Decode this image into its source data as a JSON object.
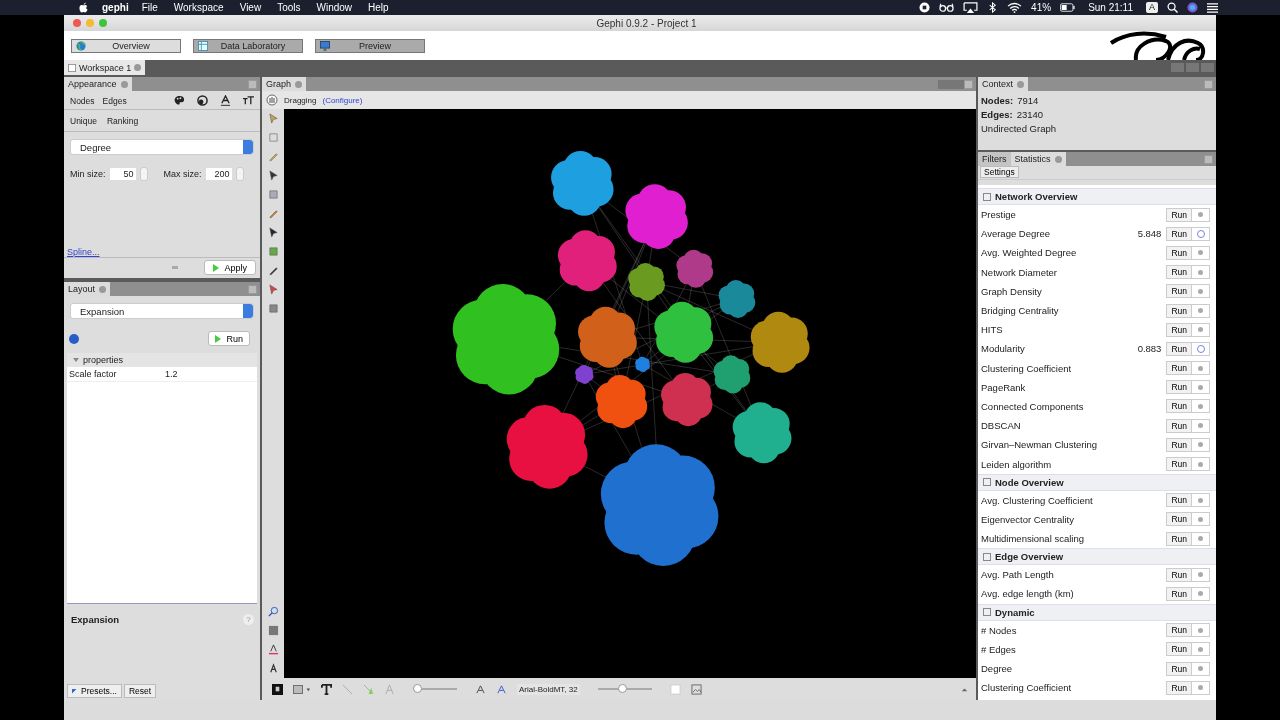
{
  "menubar": {
    "app_name": "gephi",
    "menus": [
      "File",
      "Workspace",
      "View",
      "Tools",
      "Window",
      "Help"
    ],
    "battery": "41%",
    "clock": "Sun 21:11",
    "input_source": "A"
  },
  "window": {
    "title": "Gephi 0.9.2 - Project 1"
  },
  "modes": [
    {
      "label": "Overview",
      "selected": true
    },
    {
      "label": "Data Laboratory",
      "selected": false
    },
    {
      "label": "Preview",
      "selected": false
    }
  ],
  "workspace_tabs": [
    {
      "label": "Workspace 1"
    }
  ],
  "appearance": {
    "title": "Appearance",
    "element_tabs": [
      "Nodes",
      "Edges"
    ],
    "mode_tabs": [
      "Unique",
      "Ranking"
    ],
    "attribute": "Degree",
    "min_label": "Min size:",
    "min_value": "50",
    "max_label": "Max size:",
    "max_value": "200",
    "spline_link": "Spline...",
    "apply": "Apply"
  },
  "layout": {
    "title": "Layout",
    "algorithm": "Expansion",
    "run": "Run",
    "section": "properties",
    "properties": [
      {
        "name": "Scale factor",
        "value": "1.2"
      }
    ],
    "description_title": "Expansion",
    "help": "?",
    "presets": "Presets...",
    "reset": "Reset"
  },
  "graph": {
    "title": "Graph",
    "mode": "Dragging",
    "configure": "(Configure)",
    "label_font": "Arial-BoldMT, 32",
    "edge_slider": {
      "level": 0.0
    },
    "label_slider": {
      "level": 0.45
    }
  },
  "context": {
    "title": "Context",
    "nodes_label": "Nodes:",
    "nodes": "7914",
    "edges_label": "Edges:",
    "edges": "23140",
    "graph_type": "Undirected Graph"
  },
  "statistics": {
    "tabs": [
      {
        "label": "Filters",
        "selected": false
      },
      {
        "label": "Statistics",
        "selected": true
      }
    ],
    "settings": "Settings",
    "groups": [
      {
        "title": "Network Overview",
        "items": [
          {
            "name": "Prestige",
            "button": "Run",
            "report": false
          },
          {
            "name": "Average Degree",
            "value": "5.848",
            "button": "Run",
            "report": true
          },
          {
            "name": "Avg. Weighted Degree",
            "button": "Run",
            "report": false
          },
          {
            "name": "Network Diameter",
            "button": "Run",
            "report": false
          },
          {
            "name": "Graph Density",
            "button": "Run",
            "report": false
          },
          {
            "name": "Bridging Centrality",
            "button": "Run",
            "report": false
          },
          {
            "name": "HITS",
            "button": "Run",
            "report": false
          },
          {
            "name": "Modularity",
            "value": "0.883",
            "button": "Run",
            "report": true
          },
          {
            "name": "Clustering Coefficient",
            "button": "Run",
            "report": false
          },
          {
            "name": "PageRank",
            "button": "Run",
            "report": false
          },
          {
            "name": "Connected Components",
            "button": "Run",
            "report": false
          },
          {
            "name": "DBSCAN",
            "button": "Run",
            "report": false
          },
          {
            "name": "Girvan–Newman Clustering",
            "button": "Run",
            "report": false
          },
          {
            "name": "Leiden algorithm",
            "button": "Run",
            "report": false
          }
        ]
      },
      {
        "title": "Node Overview",
        "items": [
          {
            "name": "Avg. Clustering Coefficient",
            "button": "Run",
            "report": false
          },
          {
            "name": "Eigenvector Centrality",
            "button": "Run",
            "report": false
          },
          {
            "name": "Multidimensional scaling",
            "button": "Run",
            "report": false
          }
        ]
      },
      {
        "title": "Edge Overview",
        "items": [
          {
            "name": "Avg. Path Length",
            "button": "Run",
            "report": false
          },
          {
            "name": "Avg. edge length (km)",
            "button": "Run",
            "report": false
          }
        ]
      },
      {
        "title": "Dynamic",
        "items": [
          {
            "name": "# Nodes",
            "button": "Run",
            "report": false
          },
          {
            "name": "# Edges",
            "button": "Run",
            "report": false
          },
          {
            "name": "Degree",
            "button": "Run",
            "report": false
          },
          {
            "name": "Clustering Coefficient",
            "button": "Run",
            "report": false
          }
        ]
      }
    ]
  }
}
